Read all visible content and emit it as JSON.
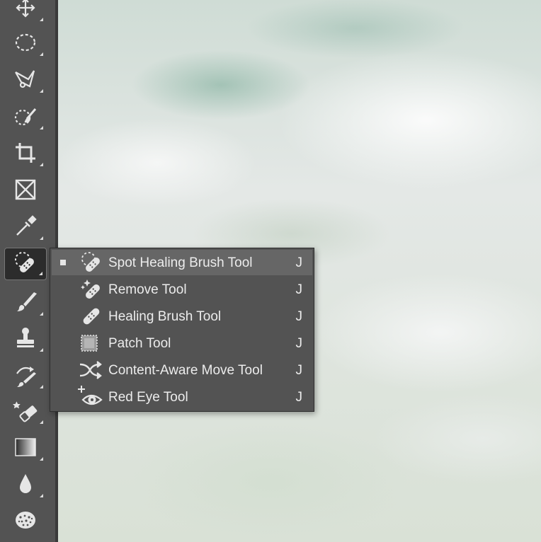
{
  "toolbar": {
    "tools": [
      {
        "name": "move-tool",
        "icon": "move-icon"
      },
      {
        "name": "marquee-tool",
        "icon": "elliptical-marquee-icon"
      },
      {
        "name": "lasso-tool",
        "icon": "polygonal-lasso-icon"
      },
      {
        "name": "object-selection-tool",
        "icon": "quick-selection-icon"
      },
      {
        "name": "crop-tool",
        "icon": "crop-icon"
      },
      {
        "name": "frame-tool",
        "icon": "frame-icon"
      },
      {
        "name": "eyedropper-tool",
        "icon": "eyedropper-icon"
      },
      {
        "name": "spot-healing-tool",
        "icon": "spot-healing-brush-icon",
        "active": true
      },
      {
        "name": "brush-tool",
        "icon": "brush-icon"
      },
      {
        "name": "clone-stamp-tool",
        "icon": "stamp-icon"
      },
      {
        "name": "history-brush-tool",
        "icon": "history-brush-icon"
      },
      {
        "name": "eraser-tool",
        "icon": "eraser-icon"
      },
      {
        "name": "gradient-tool",
        "icon": "gradient-icon"
      },
      {
        "name": "blur-tool",
        "icon": "blur-drop-icon"
      },
      {
        "name": "sponge-tool",
        "icon": "sponge-icon"
      }
    ]
  },
  "flyout": {
    "items": [
      {
        "label": "Spot Healing Brush Tool",
        "shortcut": "J",
        "icon": "spot-healing-brush-icon",
        "selected": true
      },
      {
        "label": "Remove Tool",
        "shortcut": "J",
        "icon": "remove-tool-icon"
      },
      {
        "label": "Healing Brush Tool",
        "shortcut": "J",
        "icon": "healing-brush-icon"
      },
      {
        "label": "Patch Tool",
        "shortcut": "J",
        "icon": "patch-icon"
      },
      {
        "label": "Content-Aware Move Tool",
        "shortcut": "J",
        "icon": "content-aware-move-icon"
      },
      {
        "label": "Red Eye Tool",
        "shortcut": "J",
        "icon": "red-eye-icon"
      }
    ]
  },
  "colors": {
    "toolbar_bg": "#535353",
    "menu_bg": "#535353",
    "menu_selected": "#666666",
    "icon": "#e6e6e6"
  }
}
